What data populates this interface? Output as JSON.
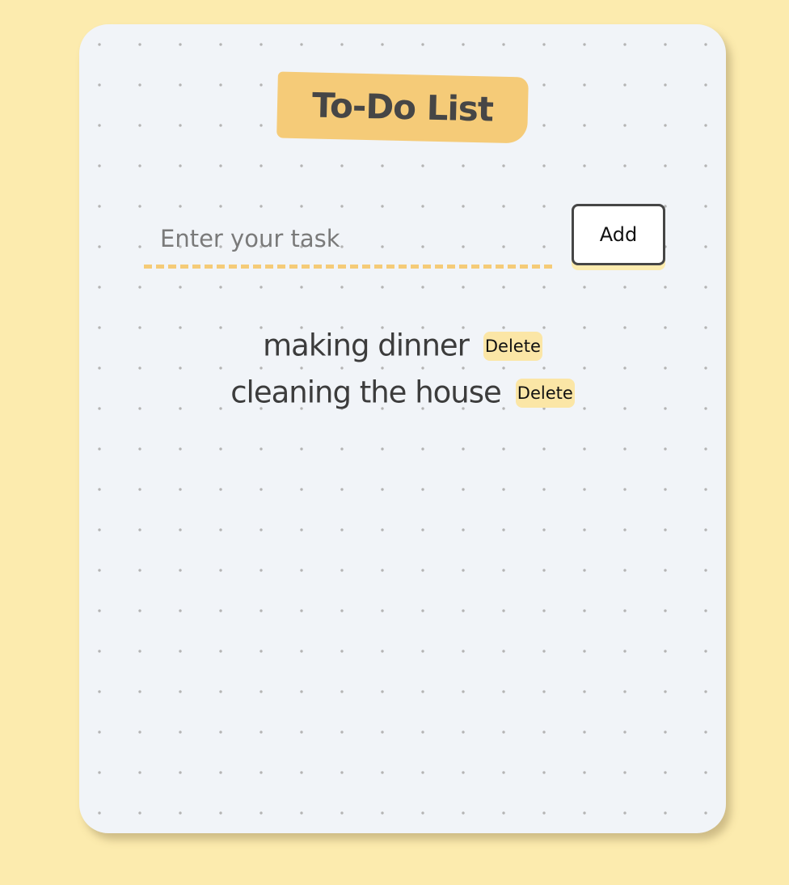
{
  "header": {
    "title": "To-Do List"
  },
  "form": {
    "input_value": "",
    "input_placeholder": "Enter your task",
    "add_label": "Add"
  },
  "tasks": [
    {
      "text": "making dinner",
      "delete_label": "Delete"
    },
    {
      "text": "cleaning the house",
      "delete_label": "Delete"
    }
  ],
  "colors": {
    "page_background": "#fcebae",
    "card_background": "#f1f4f8",
    "accent": "#f5cb78",
    "delete_button": "#fbe6a6",
    "text": "#464646",
    "dot_grid": "#b4b4b4"
  }
}
